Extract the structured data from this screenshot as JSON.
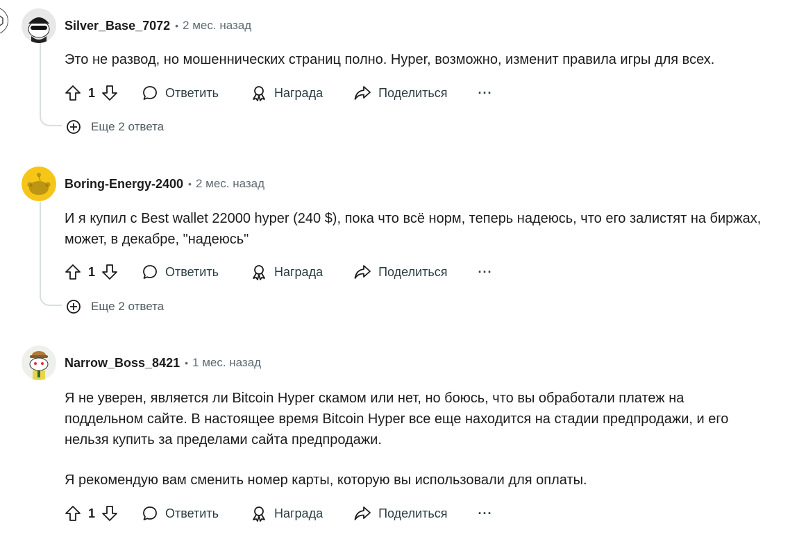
{
  "comments": [
    {
      "username": "Silver_Base_7072",
      "separator": "•",
      "time": "2 мес. назад",
      "paragraphs": [
        "Это не развод, но мошеннических страниц полно. Hyper, возможно, изменит правила игры для всех."
      ],
      "score": "1",
      "reply_label": "Ответить",
      "award_label": "Награда",
      "share_label": "Поделиться",
      "more_label": "···",
      "more_replies": "Еще 2 ответа"
    },
    {
      "username": "Boring-Energy-2400",
      "separator": "•",
      "time": "2 мес. назад",
      "paragraphs": [
        "И я купил с Best wallet 22000 hyper (240 $), пока что всё норм, теперь надеюсь, что его залистят на биржах, может, в декабре, \"надеюсь\""
      ],
      "score": "1",
      "reply_label": "Ответить",
      "award_label": "Награда",
      "share_label": "Поделиться",
      "more_label": "···",
      "more_replies": "Еще 2 ответа"
    },
    {
      "username": "Narrow_Boss_8421",
      "separator": "•",
      "time": "1 мес. назад",
      "paragraphs": [
        "Я не уверен, является ли Bitcoin Hyper скамом или нет, но боюсь, что вы обработали платеж на поддельном сайте. В настоящее время Bitcoin Hyper все еще находится на стадии предпродажи, и его нельзя купить за пределами сайта предпродажи.",
        "Я рекомендую вам сменить номер карты, которую вы использовали для оплаты."
      ],
      "score": "1",
      "reply_label": "Ответить",
      "award_label": "Награда",
      "share_label": "Поделиться",
      "more_label": "···"
    }
  ]
}
